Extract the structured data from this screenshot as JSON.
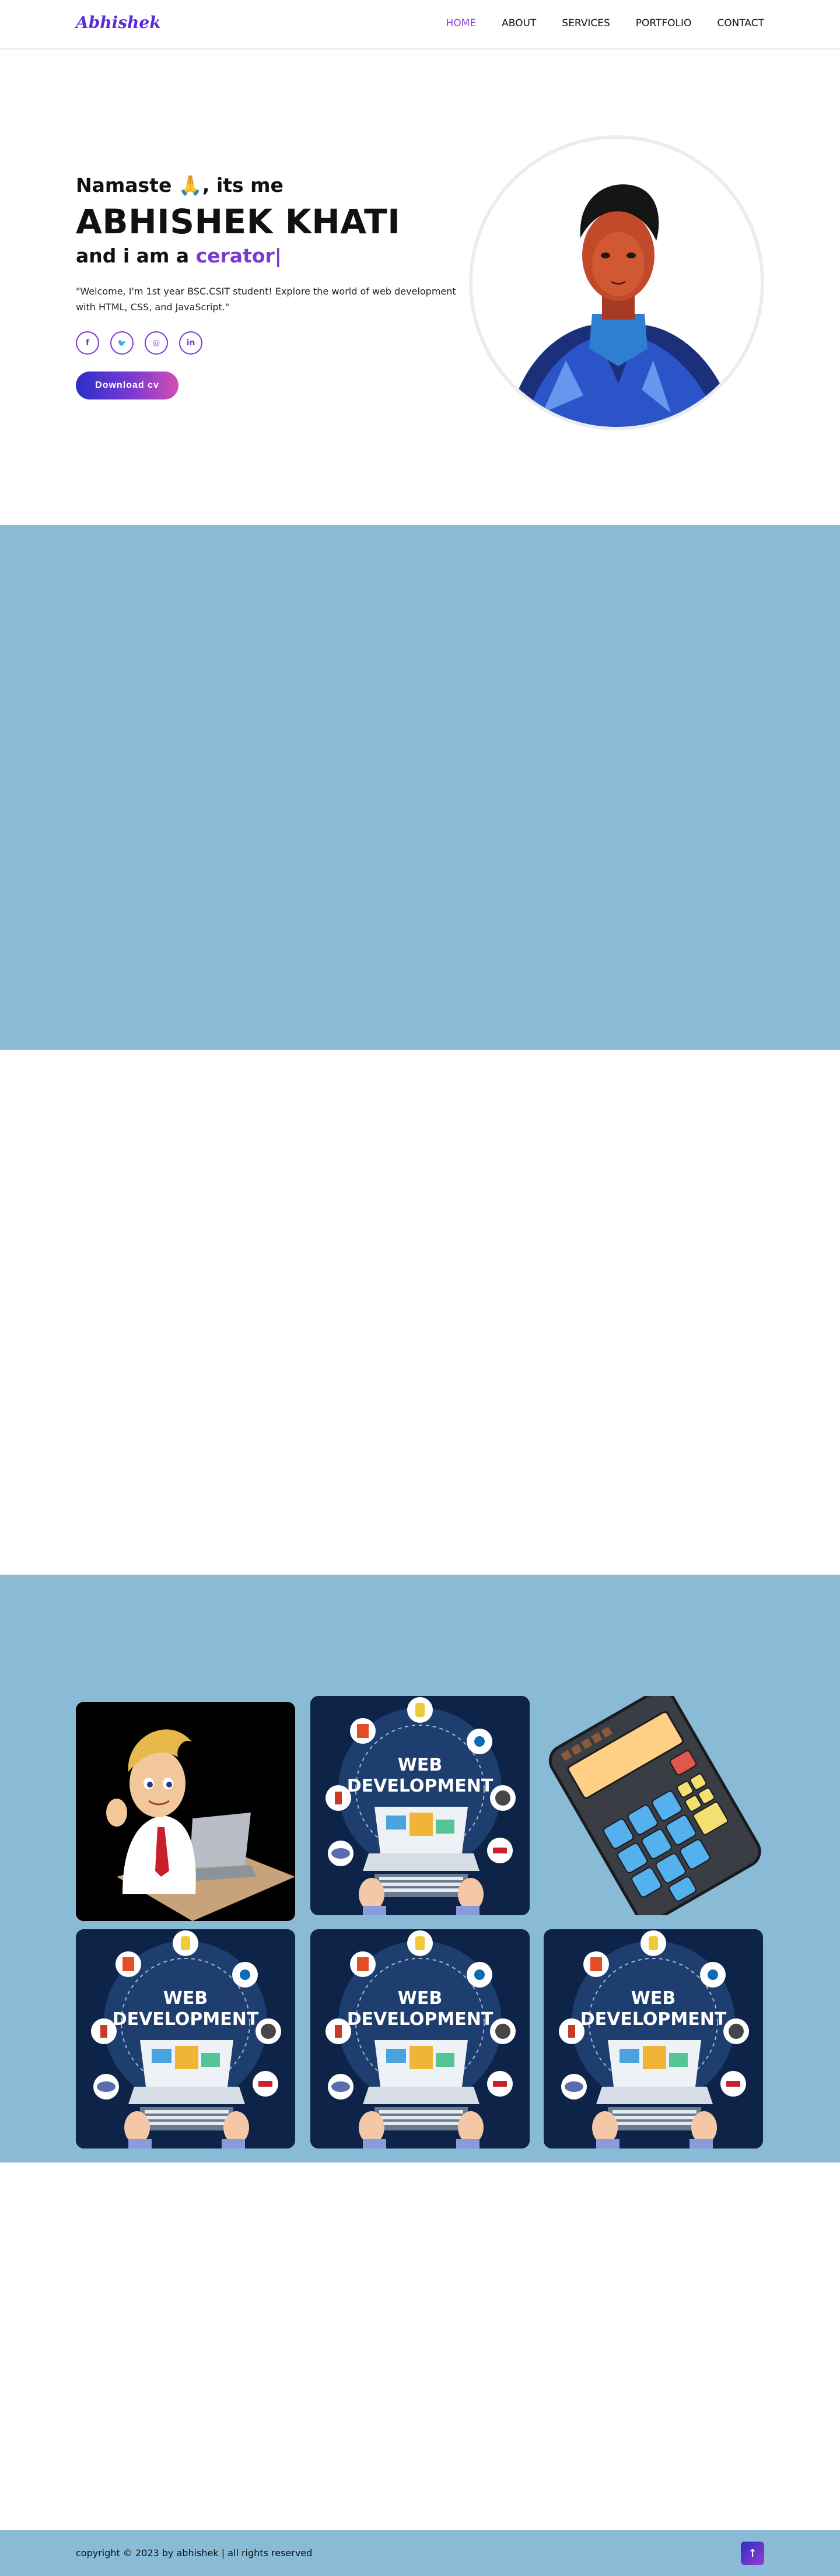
{
  "header": {
    "logo": "Abhishek",
    "nav": [
      "HOME",
      "ABOUT",
      "SERVICES",
      "PORTFOLIO",
      "CONTACT"
    ],
    "active": "HOME"
  },
  "hero": {
    "greeting": "Namaste 🙏, its me",
    "name": "ABHISHEK KHATI",
    "role_prefix": "and i am a ",
    "role_word": "cerator",
    "cursor": "|",
    "intro": "\"Welcome, I'm 1st year BSC.CSIT student! Explore the world of web development with HTML, CSS, and JavaScript.\"",
    "socials": [
      {
        "icon": "facebook-icon",
        "glyph": "f"
      },
      {
        "icon": "twitter-icon",
        "glyph": "🐦"
      },
      {
        "icon": "instagram-icon",
        "glyph": "◎"
      },
      {
        "icon": "linkedin-icon",
        "glyph": "in"
      }
    ],
    "cv_button": "Download cv"
  },
  "portfolio": {
    "web_title_line1": "WEB",
    "web_title_line2": "DEVELOPMENT",
    "badges": [
      "HTML5",
      "JS",
      "jQuery",
      "WordPress",
      "Java",
      "PHP",
      "Rails"
    ],
    "items": [
      "cartoon",
      "web",
      "calculator",
      "web",
      "web",
      "web"
    ]
  },
  "footer": {
    "copyright": "copyright © 2023 by abhishek | all rights reserved",
    "top_icon": "arrow-up-icon"
  },
  "colors": {
    "accent": "#7b3ad0",
    "band": "#8abbd6",
    "navy": "#0e2348"
  }
}
